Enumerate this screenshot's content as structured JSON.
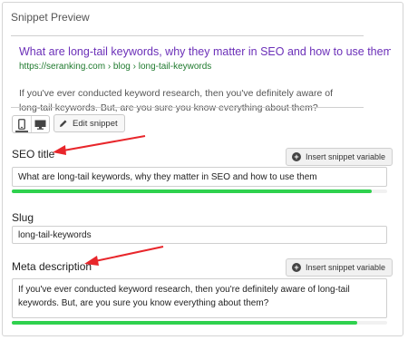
{
  "panel": {
    "title": "Snippet Preview"
  },
  "preview": {
    "title": "What are long-tail keywords, why they matter in SEO and how to use them",
    "url": "https://seranking.com › blog › long-tail-keywords",
    "description": "If you've ever conducted keyword research, then you've definitely aware of long-tail keywords. But, are you sure you know everything about them?"
  },
  "toolbar": {
    "mobile_icon": "mobile-phone-icon",
    "desktop_icon": "desktop-monitor-icon",
    "edit_icon": "pencil-icon",
    "edit_label": "Edit snippet"
  },
  "fields": {
    "insert_label": "Insert snippet variable",
    "insert_icon": "plus-circle-icon",
    "seo_title": {
      "label": "SEO title",
      "value": "What are long-tail keywords, why they matter in SEO and how to use them",
      "progress_pct": 96
    },
    "slug": {
      "label": "Slug",
      "value": "long-tail-keywords"
    },
    "meta_description": {
      "label": "Meta description",
      "value": "If you've ever conducted keyword research, then you're definitely aware of long-tail keywords. But, are you sure you know everything about them?",
      "progress_pct": 92
    }
  },
  "colors": {
    "progress_good": "#2fd14e",
    "annotation_arrow": "#e8262b",
    "link_title": "#6b2fb8",
    "url_green": "#1f7a2e"
  }
}
